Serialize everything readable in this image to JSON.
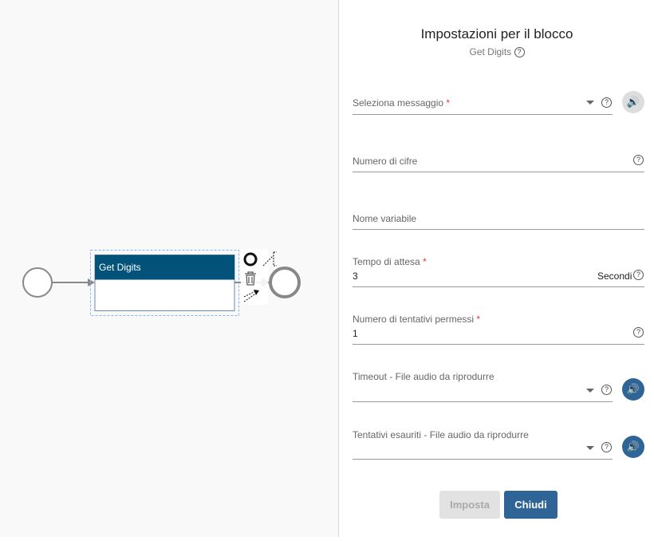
{
  "canvas": {
    "block_title": "Get Digits"
  },
  "panel": {
    "title": "Impostazioni per il blocco",
    "subtitle": "Get Digits",
    "fields": [
      {
        "label": "Seleziona messaggio",
        "required": "*",
        "value": ""
      },
      {
        "label": "Numero di cifre",
        "value": ""
      },
      {
        "label": "Nome variabile",
        "value": ""
      },
      {
        "label": "Tempo di attesa",
        "required": "*",
        "value": "3",
        "unit": "Secondi"
      },
      {
        "label": "Numero di tentativi permessi",
        "required": "*",
        "value": "1"
      },
      {
        "label": "Timeout - File audio da riprodurre",
        "value": ""
      },
      {
        "label": "Tentativi esauriti - File audio da riprodurre",
        "value": ""
      }
    ],
    "help_glyph": "?",
    "speaker_glyph": "🔊",
    "buttons": {
      "apply": "Imposta",
      "close": "Chiudi"
    }
  },
  "colors": {
    "block_header": "#02527a",
    "primary": "#2f6496",
    "required": "#e53935"
  }
}
